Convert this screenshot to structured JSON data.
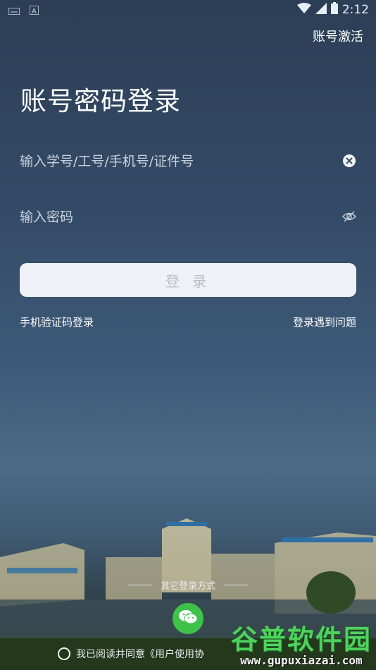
{
  "status_bar": {
    "time": "2:12"
  },
  "header": {
    "activate_label": "账号激活"
  },
  "page_title": "账号密码登录",
  "account_field": {
    "placeholder": "输入学号/工号/手机号/证件号"
  },
  "password_field": {
    "placeholder": "输入密码"
  },
  "login_button": "登 录",
  "links": {
    "sms_login": "手机验证码登录",
    "trouble": "登录遇到问题"
  },
  "other_login": {
    "label": "其它登录方式",
    "icons": [
      "wechat-icon"
    ]
  },
  "agreement": {
    "text": "我已阅读并同意《用户使用协"
  },
  "watermark": {
    "title": "谷普软件园",
    "url": "www.gupuxiazai.com"
  },
  "colors": {
    "wechat": "#3fc24a",
    "button_bg": "#eef1f6",
    "button_text": "#b9bec7",
    "caret": "#4f8cff"
  }
}
